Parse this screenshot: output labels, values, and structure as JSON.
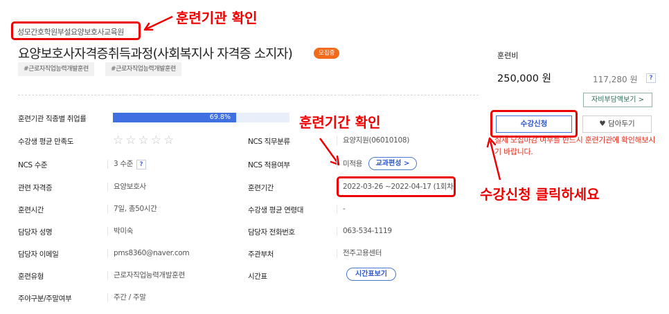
{
  "header": {
    "institute": "성모간호학원부설요양보호사교육원",
    "course_title": "요양보호사자격증취득과정(사회복지사 자격증 소지자)",
    "status_badge": "모집중",
    "tags": [
      "#근로자직업능력개발훈련",
      "#근로자직업능력개발훈련"
    ]
  },
  "annotations": {
    "institute_check": "훈련기관 확인",
    "period_check": "훈련기간 확인",
    "apply_click": "수강신청 클릭하세요"
  },
  "info": {
    "employment_rate_label": "훈련기관 직종별 취업률",
    "employment_rate_text": "69.8%",
    "employment_rate": 0.698,
    "satisfaction_label": "수강생 평균 만족도",
    "satisfaction_stars": "☆☆☆☆☆",
    "satisfaction_rating": 0,
    "ncs_job_label": "NCS 직무분류",
    "ncs_job_value": "요양지원(06010108)",
    "ncs_level_label": "NCS 수준",
    "ncs_level_value": "3 수준",
    "ncs_apply_label": "NCS 적용여부",
    "ncs_apply_value": "미적용",
    "curriculum_button": "교과편성 >",
    "cert_label": "관련 자격증",
    "cert_value": "요양보호사",
    "period_label": "훈련기간",
    "period_value": "2022-03-26 ~2022-04-17 (1회차)",
    "hours_label": "훈련시간",
    "hours_value": "7일, 총50시간",
    "age_label": "수강생 평균 연령대",
    "age_value": "-",
    "manager_label": "담당자 성명",
    "manager_value": "박미숙",
    "phone_label": "담당자 전화번호",
    "phone_value": "063-534-1119",
    "email_label": "담당자 이메일",
    "email_value": "pms8360@naver.com",
    "agency_label": "주관부처",
    "agency_value": "전주고용센터",
    "type_label": "훈련유형",
    "type_value": "근로자직업능력개발훈련",
    "timetable_label": "시간표",
    "timetable_button": "시간표보기",
    "weekday_label": "주야구분/주말여부",
    "weekday_value": "주간 / 주말"
  },
  "side": {
    "fee_label": "훈련비",
    "fee_main": "250,000 원",
    "fee_sub": "117,280 원",
    "help": "?",
    "self_pay_button": "자비부담액보기 >",
    "apply_button": "수강신청",
    "wish_button": "담아두기",
    "notice": "실제 모집마감 여부를 반드시 훈련기관에 확인해보시기 바랍니다."
  },
  "colors": {
    "annotation_red": "#ee0000",
    "primary_blue": "#3f6fe0",
    "status_orange": "#f06c1c"
  },
  "icons": {
    "heart": "heart-icon",
    "arrow": "arrow-icon"
  }
}
